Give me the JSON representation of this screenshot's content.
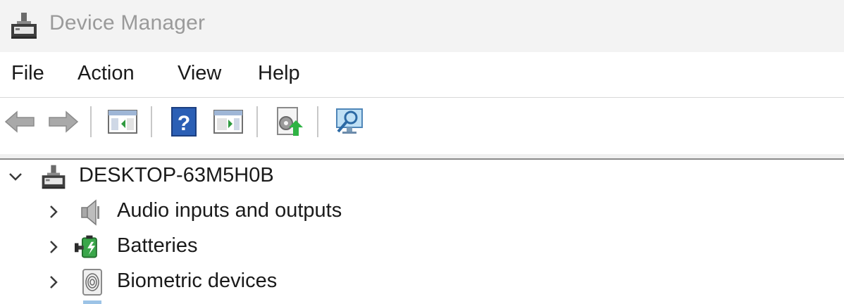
{
  "window": {
    "title": "Device Manager",
    "title_icon": "device-manager-icon"
  },
  "menu": {
    "items": [
      "File",
      "Action",
      "View",
      "Help"
    ]
  },
  "toolbar": {
    "buttons": [
      {
        "name": "back",
        "icon": "back-arrow-icon"
      },
      {
        "name": "forward",
        "icon": "forward-arrow-icon"
      },
      {
        "name": "show-hide-console-tree",
        "icon": "console-tree-icon"
      },
      {
        "name": "help",
        "icon": "help-icon"
      },
      {
        "name": "show-hide-action-pane",
        "icon": "action-pane-icon"
      },
      {
        "name": "update-driver",
        "icon": "update-driver-icon"
      },
      {
        "name": "scan-hardware-changes",
        "icon": "scan-monitor-icon"
      }
    ]
  },
  "tree": {
    "root": {
      "label": "DESKTOP-63M5H0B",
      "icon": "computer-icon",
      "expanded": true
    },
    "children": [
      {
        "label": "Audio inputs and outputs",
        "icon": "speaker-icon",
        "expanded": false
      },
      {
        "label": "Batteries",
        "icon": "battery-icon",
        "expanded": false
      },
      {
        "label": "Biometric devices",
        "icon": "fingerprint-icon",
        "expanded": false
      }
    ]
  },
  "colors": {
    "titlebar_bg": "#f3f3f3",
    "title_text": "#9a9a9a",
    "text": "#1a1a1a",
    "accent_blue": "#2b5fb5",
    "green": "#3aa64a"
  }
}
